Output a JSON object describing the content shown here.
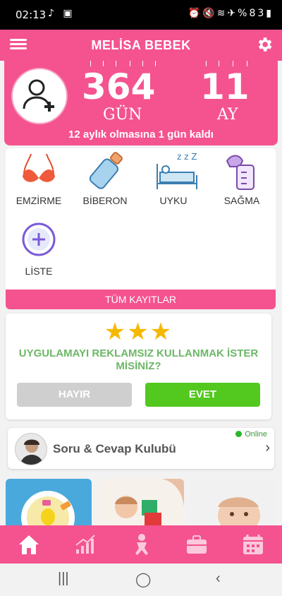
{
  "status_bar": {
    "time": "02:13",
    "battery": "%83"
  },
  "app_bar": {
    "title": "MELİSA BEBEK"
  },
  "hero": {
    "days_value": "364",
    "days_unit": "GÜN",
    "months_value": "11",
    "months_unit": "AY",
    "remaining_text": "12 aylık olmasına 1 gün kaldı"
  },
  "activities": [
    {
      "label": "EMZİRME",
      "icon": "bra-icon"
    },
    {
      "label": "BİBERON",
      "icon": "baby-bottle-icon"
    },
    {
      "label": "UYKU",
      "icon": "sleep-bed-icon"
    },
    {
      "label": "SAĞMA",
      "icon": "breast-pump-icon"
    },
    {
      "label": "LİSTE",
      "icon": "plus-circle-icon"
    }
  ],
  "all_records_label": "TÜM KAYITLAR",
  "ad_prompt": {
    "question": "UYGULAMAYI REKLAMSIZ KULLANMAK İSTER MİSİNİZ?",
    "no_label": "HAYIR",
    "yes_label": "EVET"
  },
  "club": {
    "name": "Soru & Cevap Kulubü",
    "status": "Online"
  },
  "colors": {
    "brand_pink": "#f4538f",
    "yes_green": "#53c81f",
    "question_green": "#6cb766",
    "star_gold": "#f5b800"
  }
}
